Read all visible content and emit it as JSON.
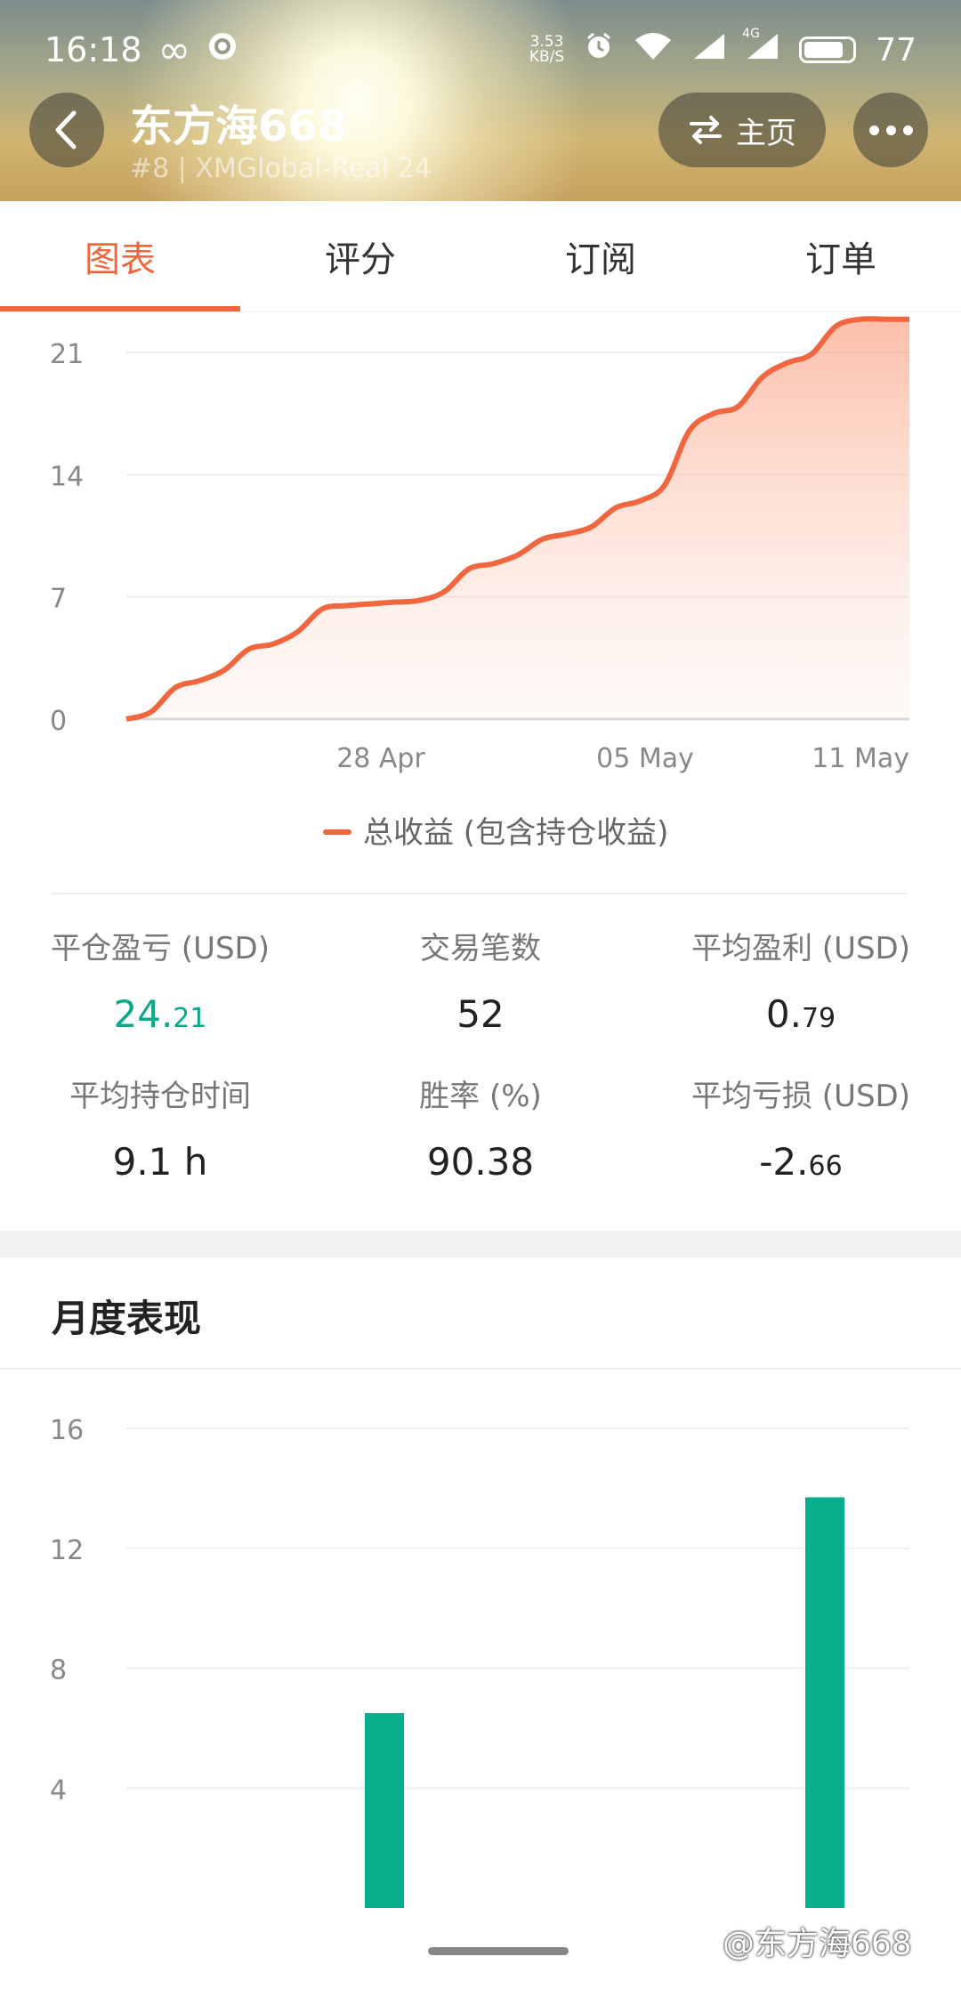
{
  "status_bar": {
    "time": "16:18",
    "infinity": "∞",
    "net_speed_value": "3.53",
    "net_speed_unit": "KB/S",
    "network": "4G",
    "battery": "77"
  },
  "header": {
    "title": "东方海668",
    "subtitle": "#8 | XMGlobal-Real 24",
    "home_label": "主页"
  },
  "tabs": [
    {
      "label": "图表",
      "active": true
    },
    {
      "label": "评分",
      "active": false
    },
    {
      "label": "订阅",
      "active": false
    },
    {
      "label": "订单",
      "active": false
    }
  ],
  "colors": {
    "accent": "#f0663f",
    "green": "#08a987",
    "bar": "#09ad8c"
  },
  "chart_data": [
    {
      "type": "area",
      "y_ticks": [
        "0",
        "7",
        "14",
        "21"
      ],
      "x_ticks": [
        "28 Apr",
        "05 May",
        "11 May"
      ],
      "ylim": [
        0,
        21
      ],
      "legend": "总收益 (包含持仓收益)",
      "series": [
        {
          "name": "总收益 (包含持仓收益)",
          "x": [
            0,
            0.5,
            1,
            1.5,
            2,
            2.5,
            3,
            3.5,
            4,
            4.5,
            5,
            5.5,
            6,
            6.5,
            7,
            7.5,
            8,
            8.5,
            9,
            9.5,
            10,
            10.5,
            11,
            11.5,
            12,
            12.5,
            13,
            13.5,
            14,
            14.5,
            15,
            15.5,
            16
          ],
          "values": [
            0,
            0.4,
            1.8,
            2.2,
            2.8,
            4.0,
            4.3,
            5.0,
            6.3,
            6.5,
            6.6,
            6.7,
            6.8,
            7.3,
            8.6,
            8.9,
            9.4,
            10.3,
            10.6,
            11.0,
            12.1,
            12.5,
            13.4,
            16.5,
            17.5,
            17.9,
            19.6,
            20.4,
            20.9,
            22.5,
            22.9,
            22.9,
            22.9
          ]
        }
      ]
    },
    {
      "type": "bar",
      "title": "月度表现",
      "y_ticks": [
        "4",
        "8",
        "12",
        "16"
      ],
      "ylim": [
        0,
        16
      ],
      "categories": [
        "",
        "",
        "",
        "",
        "",
        ""
      ],
      "values": [
        0,
        6.5,
        0,
        0,
        13.7,
        0
      ]
    }
  ],
  "stats": [
    {
      "label": "平仓盈亏 (USD)",
      "int": "24.",
      "dec": "21",
      "green": true
    },
    {
      "label": "交易笔数",
      "int": "52",
      "dec": "",
      "green": false
    },
    {
      "label": "平均盈利 (USD)",
      "int": "0.",
      "dec": "79",
      "green": false
    },
    {
      "label": "平均持仓时间",
      "int": "9.1 h",
      "dec": "",
      "green": false
    },
    {
      "label": "胜率 (%)",
      "int": "90.38",
      "dec": "",
      "green": false
    },
    {
      "label": "平均亏损 (USD)",
      "int": "-2.",
      "dec": "66",
      "green": false
    }
  ],
  "watermark": "@东方海668"
}
